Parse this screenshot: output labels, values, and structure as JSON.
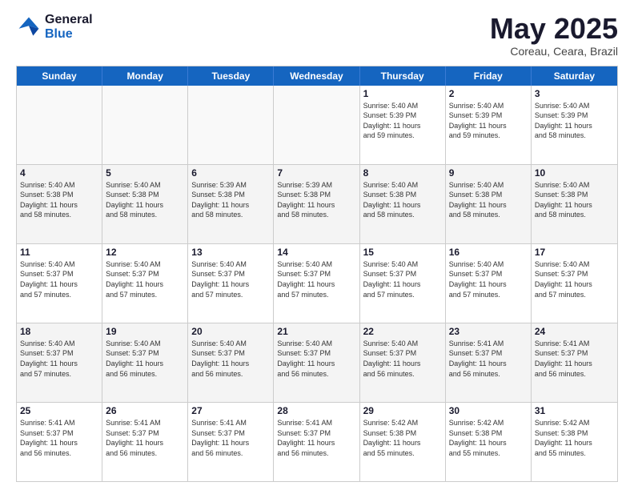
{
  "logo": {
    "line1": "General",
    "line2": "Blue"
  },
  "title": "May 2025",
  "location": "Coreau, Ceara, Brazil",
  "days": [
    "Sunday",
    "Monday",
    "Tuesday",
    "Wednesday",
    "Thursday",
    "Friday",
    "Saturday"
  ],
  "weeks": [
    [
      {
        "day": "",
        "text": "",
        "empty": true
      },
      {
        "day": "",
        "text": "",
        "empty": true
      },
      {
        "day": "",
        "text": "",
        "empty": true
      },
      {
        "day": "",
        "text": "",
        "empty": true
      },
      {
        "day": "1",
        "text": "Sunrise: 5:40 AM\nSunset: 5:39 PM\nDaylight: 11 hours\nand 59 minutes."
      },
      {
        "day": "2",
        "text": "Sunrise: 5:40 AM\nSunset: 5:39 PM\nDaylight: 11 hours\nand 59 minutes."
      },
      {
        "day": "3",
        "text": "Sunrise: 5:40 AM\nSunset: 5:39 PM\nDaylight: 11 hours\nand 58 minutes."
      }
    ],
    [
      {
        "day": "4",
        "text": "Sunrise: 5:40 AM\nSunset: 5:38 PM\nDaylight: 11 hours\nand 58 minutes."
      },
      {
        "day": "5",
        "text": "Sunrise: 5:40 AM\nSunset: 5:38 PM\nDaylight: 11 hours\nand 58 minutes."
      },
      {
        "day": "6",
        "text": "Sunrise: 5:39 AM\nSunset: 5:38 PM\nDaylight: 11 hours\nand 58 minutes."
      },
      {
        "day": "7",
        "text": "Sunrise: 5:39 AM\nSunset: 5:38 PM\nDaylight: 11 hours\nand 58 minutes."
      },
      {
        "day": "8",
        "text": "Sunrise: 5:40 AM\nSunset: 5:38 PM\nDaylight: 11 hours\nand 58 minutes."
      },
      {
        "day": "9",
        "text": "Sunrise: 5:40 AM\nSunset: 5:38 PM\nDaylight: 11 hours\nand 58 minutes."
      },
      {
        "day": "10",
        "text": "Sunrise: 5:40 AM\nSunset: 5:38 PM\nDaylight: 11 hours\nand 58 minutes."
      }
    ],
    [
      {
        "day": "11",
        "text": "Sunrise: 5:40 AM\nSunset: 5:37 PM\nDaylight: 11 hours\nand 57 minutes."
      },
      {
        "day": "12",
        "text": "Sunrise: 5:40 AM\nSunset: 5:37 PM\nDaylight: 11 hours\nand 57 minutes."
      },
      {
        "day": "13",
        "text": "Sunrise: 5:40 AM\nSunset: 5:37 PM\nDaylight: 11 hours\nand 57 minutes."
      },
      {
        "day": "14",
        "text": "Sunrise: 5:40 AM\nSunset: 5:37 PM\nDaylight: 11 hours\nand 57 minutes."
      },
      {
        "day": "15",
        "text": "Sunrise: 5:40 AM\nSunset: 5:37 PM\nDaylight: 11 hours\nand 57 minutes."
      },
      {
        "day": "16",
        "text": "Sunrise: 5:40 AM\nSunset: 5:37 PM\nDaylight: 11 hours\nand 57 minutes."
      },
      {
        "day": "17",
        "text": "Sunrise: 5:40 AM\nSunset: 5:37 PM\nDaylight: 11 hours\nand 57 minutes."
      }
    ],
    [
      {
        "day": "18",
        "text": "Sunrise: 5:40 AM\nSunset: 5:37 PM\nDaylight: 11 hours\nand 57 minutes."
      },
      {
        "day": "19",
        "text": "Sunrise: 5:40 AM\nSunset: 5:37 PM\nDaylight: 11 hours\nand 56 minutes."
      },
      {
        "day": "20",
        "text": "Sunrise: 5:40 AM\nSunset: 5:37 PM\nDaylight: 11 hours\nand 56 minutes."
      },
      {
        "day": "21",
        "text": "Sunrise: 5:40 AM\nSunset: 5:37 PM\nDaylight: 11 hours\nand 56 minutes."
      },
      {
        "day": "22",
        "text": "Sunrise: 5:40 AM\nSunset: 5:37 PM\nDaylight: 11 hours\nand 56 minutes."
      },
      {
        "day": "23",
        "text": "Sunrise: 5:41 AM\nSunset: 5:37 PM\nDaylight: 11 hours\nand 56 minutes."
      },
      {
        "day": "24",
        "text": "Sunrise: 5:41 AM\nSunset: 5:37 PM\nDaylight: 11 hours\nand 56 minutes."
      }
    ],
    [
      {
        "day": "25",
        "text": "Sunrise: 5:41 AM\nSunset: 5:37 PM\nDaylight: 11 hours\nand 56 minutes."
      },
      {
        "day": "26",
        "text": "Sunrise: 5:41 AM\nSunset: 5:37 PM\nDaylight: 11 hours\nand 56 minutes."
      },
      {
        "day": "27",
        "text": "Sunrise: 5:41 AM\nSunset: 5:37 PM\nDaylight: 11 hours\nand 56 minutes."
      },
      {
        "day": "28",
        "text": "Sunrise: 5:41 AM\nSunset: 5:37 PM\nDaylight: 11 hours\nand 56 minutes."
      },
      {
        "day": "29",
        "text": "Sunrise: 5:42 AM\nSunset: 5:38 PM\nDaylight: 11 hours\nand 55 minutes."
      },
      {
        "day": "30",
        "text": "Sunrise: 5:42 AM\nSunset: 5:38 PM\nDaylight: 11 hours\nand 55 minutes."
      },
      {
        "day": "31",
        "text": "Sunrise: 5:42 AM\nSunset: 5:38 PM\nDaylight: 11 hours\nand 55 minutes."
      }
    ]
  ]
}
